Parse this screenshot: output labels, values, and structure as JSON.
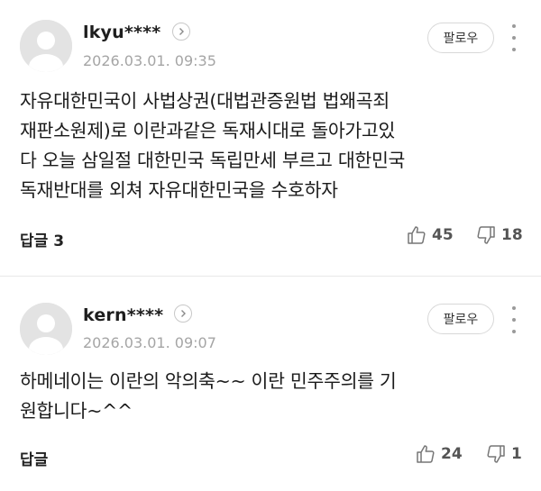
{
  "comments": [
    {
      "username": "lkyu****",
      "timestamp": "2026.03.01. 09:35",
      "follow_label": "팔로우",
      "text": "자유대한민국이 사법상권(대법관증원법 법왜곡죄\n재판소원제)로 이란과같은 독재시대로 돌아가고있\n다 오늘 삼일절 대한민국 독립만세 부르고 대한민국\n독재반대를 외쳐 자유대한민국을 수호하자",
      "reply_label": "답글 3",
      "likes": "45",
      "dislikes": "18"
    },
    {
      "username": "kern****",
      "timestamp": "2026.03.01. 09:07",
      "follow_label": "팔로우",
      "text": "하메네이는 이란의 악의축~~ 이란 민주주의를 기\n원합니다~^^",
      "reply_label": "답글",
      "likes": "24",
      "dislikes": "1"
    }
  ],
  "icons": {
    "avatar": "default-avatar-icon",
    "profile_arrow": "chevron-right-icon",
    "more": "more-vertical-icon",
    "like": "thumbs-up-icon",
    "dislike": "thumbs-down-icon"
  }
}
